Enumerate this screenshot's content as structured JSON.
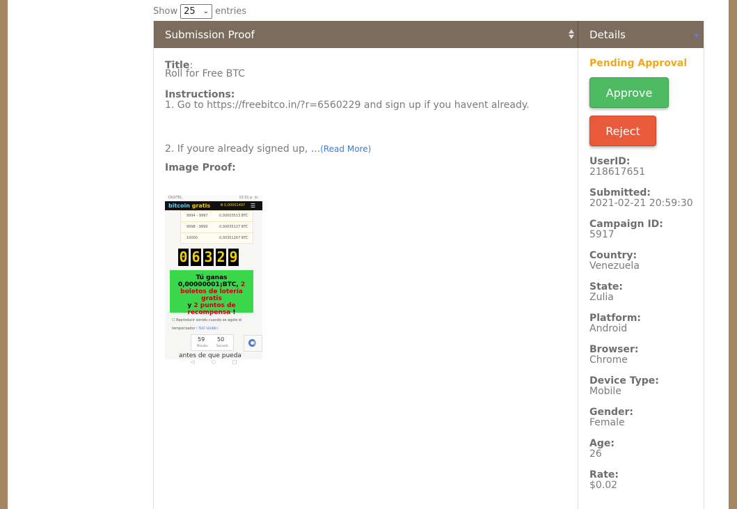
{
  "length_control": {
    "show_label": "Show",
    "selected": "25",
    "entries_label": "entries"
  },
  "columns": {
    "proof": "Submission Proof",
    "details": "Details"
  },
  "submission": {
    "title_label": "Title",
    "title_value": "Roll for Free BTC",
    "instructions_label": "Instructions:",
    "instruction_line1": "1. Go to https://freebitco.in/?r=6560229 and sign up if you havent already.",
    "instruction_line2": "2. If youre already signed up, ...",
    "read_more": "(Read More)",
    "image_proof_label": "Image Proof:"
  },
  "proof_image": {
    "status_left": "DIGITEL",
    "status_right": "10:31 p. m.",
    "brand_part1": "bitcoin",
    "brand_part2": "gratis",
    "balance": "Ƀ 0,00001497",
    "rows": [
      {
        "range": "9994 - 9997",
        "payout": "0,00003513 BTC"
      },
      {
        "range": "9998 - 9999",
        "payout": "0,00035127 BTC"
      },
      {
        "range": "10000",
        "payout": "0,00351267 BTC"
      }
    ],
    "digits": [
      "0",
      "6",
      "3",
      "2",
      "9"
    ],
    "win_line1": "Tú ganas",
    "win_amount": "0,00000001¡BTC,",
    "win_tickets_num": "2",
    "win_tickets_text": "boletos de lotería gratis",
    "win_and": "y",
    "win_points": "2 puntos de recompensa",
    "win_end": "!",
    "sound_text": "Reproducir sonido cuando se agote el temporizador",
    "test_sound": "( TEST SOUND )",
    "timer_minutes": "59",
    "timer_minutes_label": "Minutes",
    "timer_seconds": "50",
    "timer_seconds_label": "Seconds",
    "cut_text": "antes de que pueda",
    "nav_back": "◁",
    "nav_home": "○",
    "nav_recent": "□"
  },
  "details": {
    "status": "Pending Approval",
    "approve_label": "Approve",
    "reject_label": "Reject",
    "fields": [
      {
        "label": "UserID:",
        "value": "218617651"
      },
      {
        "label": "Submitted:",
        "value": "2021-02-21 20:59:30"
      },
      {
        "label": "Campaign ID:",
        "value": "5917"
      },
      {
        "label": "Country:",
        "value": "Venezuela"
      },
      {
        "label": "State:",
        "value": "Zulia"
      },
      {
        "label": "Platform:",
        "value": "Android"
      },
      {
        "label": "Browser:",
        "value": "Chrome"
      },
      {
        "label": "Device Type:",
        "value": "Mobile"
      },
      {
        "label": "Gender:",
        "value": "Female"
      },
      {
        "label": "Age:",
        "value": "26"
      },
      {
        "label": "Rate:",
        "value": "$0.02"
      }
    ]
  },
  "colors": {
    "header_bg": "#7b6c5e",
    "pending": "#f0a81c",
    "approve": "#4dbb62",
    "reject": "#e85a3a",
    "link": "#3a7bd5",
    "side_bar": "#a58661"
  }
}
